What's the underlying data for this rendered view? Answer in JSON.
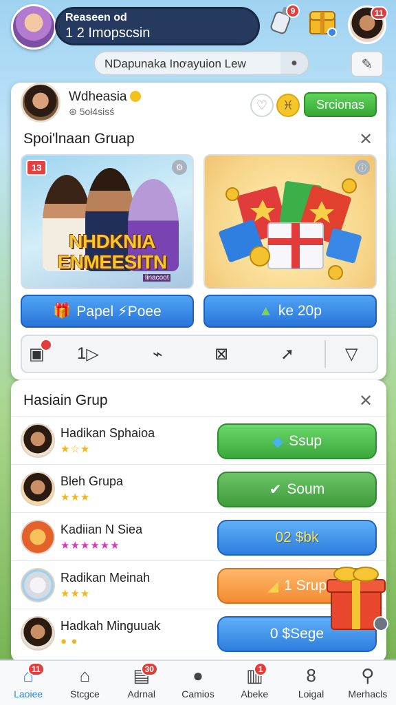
{
  "colors": {
    "primary_blue": "#2a74d8",
    "green": "#3aa83a",
    "orange": "#f38b32",
    "badge_red": "#e43b3b",
    "header_dark": "#253a5e"
  },
  "header": {
    "title_line1": "Reaseen od",
    "title_line2": "1 2 Imopscsin",
    "bottle_badge": "9",
    "chest_badge": "",
    "profile_badge": "11",
    "search_text": "NDapunaka Inơayuion Lew"
  },
  "profile": {
    "name": "Wdheasia",
    "subtitle": "⊛ 5oł4sisś",
    "action_label": "Srcionas"
  },
  "group_section": {
    "title": "Spoi'lnaan Gruap",
    "promo_left": {
      "badge": "13",
      "title": "NHDKNIA ENMEESITN",
      "caption": "linacoot"
    },
    "promo_right": {},
    "button_left": "Papel ⚡Poee",
    "button_right": "ke 20p",
    "toolbar": {
      "item2_label": "1"
    }
  },
  "list_section": {
    "title": "Hasiain Grup",
    "rows": [
      {
        "name": "Hadikan Sphaioa",
        "stars": "★☆★",
        "button": "Ssup"
      },
      {
        "name": "Bleh Grupa",
        "stars": "★★★",
        "button": "Soum"
      },
      {
        "name": "Kadiian N Siea",
        "stars": "★★★★★★",
        "button": "02 $bk"
      },
      {
        "name": "Radikan Meinah",
        "stars": "★★★",
        "button": "1 Srup"
      },
      {
        "name": "Hadkah Minguuak",
        "stars": "● ●",
        "button": "0 $Sege"
      }
    ]
  },
  "bottom_nav": {
    "items": [
      {
        "label": "Laoiee",
        "badge": "11"
      },
      {
        "label": "Stcgce",
        "badge": ""
      },
      {
        "label": "Adrnal",
        "badge": "30"
      },
      {
        "label": "Camios",
        "badge": ""
      },
      {
        "label": "Abeke",
        "badge": "1"
      },
      {
        "label": "Loigal",
        "badge": ""
      },
      {
        "label": "Merhacls",
        "badge": ""
      }
    ]
  }
}
